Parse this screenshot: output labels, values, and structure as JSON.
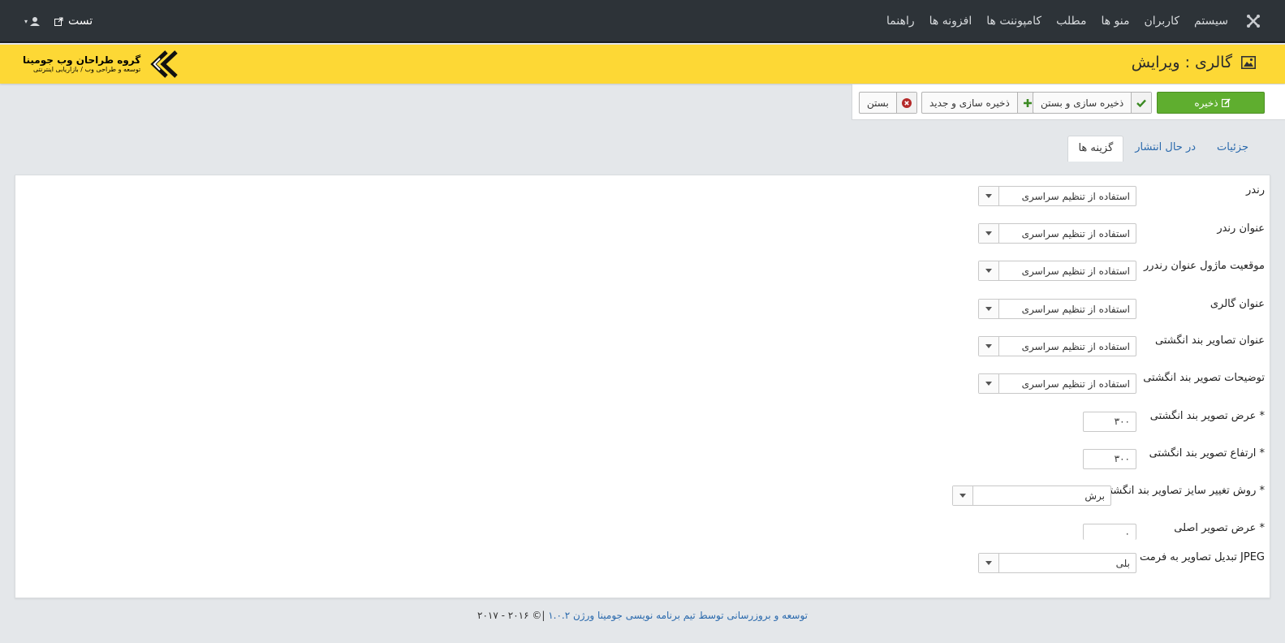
{
  "nav": {
    "items": [
      "سیستم",
      "کاربران",
      "منو ها",
      "مطلب",
      "کامپوننت ها",
      "افزونه ها",
      "راهنما"
    ],
    "site_link": "تست"
  },
  "header": {
    "title": "گالری : ویرایش",
    "brand_line1": "گروه طراحان وب جومینا",
    "brand_line2": "توسعه و طراحی وب / بازاریابی اینترنتی"
  },
  "toolbar": {
    "save": "ذخیره",
    "save_close": "ذخیره سازی و بستن",
    "save_new": "ذخیره سازی و جدید",
    "close": "بستن"
  },
  "tabs": [
    "جزئیات",
    "در حال انتشار",
    "گزینه ها"
  ],
  "active_tab": "گزینه ها",
  "form": {
    "fields": [
      {
        "label": "رندر",
        "value": "استفاده از تنظیم سراسری",
        "type": "select"
      },
      {
        "label": "عنوان رندر",
        "value": "استفاده از تنظیم سراسری",
        "type": "select"
      },
      {
        "label": "موقعیت ماژول عنوان رندرر",
        "value": "استفاده از تنظیم سراسری",
        "type": "select"
      },
      {
        "label": "عنوان گالری",
        "value": "استفاده از تنظیم سراسری",
        "type": "select"
      },
      {
        "label": "عنوان تصاویر بند انگشتی",
        "value": "استفاده از تنظیم سراسری",
        "type": "select"
      },
      {
        "label": "توضیحات تصویر بند انگشتی",
        "value": "استفاده از تنظیم سراسری",
        "type": "select"
      },
      {
        "label": "عرض تصویر بند انگشتی *",
        "value": "۳۰۰",
        "type": "input"
      },
      {
        "label": "ارتفاع تصویر بند انگشتی *",
        "value": "۳۰۰",
        "type": "input"
      },
      {
        "label": "روش تغییر سایز تصاویر بند انگشتی *",
        "value": "برش",
        "type": "select"
      },
      {
        "label": "عرض تصویر اصلی *",
        "value": "۰",
        "type": "input"
      },
      {
        "label": "تبدیل تصاویر به فرمت JPEG",
        "value": "بلی",
        "type": "select"
      }
    ]
  },
  "footer": {
    "link_text": "توسعه و بروزرسانی توسط تیم برنامه نویسی جومینا ورژن ۱.۰.۲",
    "copyright": " |© ۲۰۱۶ - ۲۰۱۷"
  },
  "colors": {
    "topnav": "#2d3338",
    "header": "#fdd835",
    "save_button": "#5fae2f",
    "link": "#2b6aad"
  }
}
